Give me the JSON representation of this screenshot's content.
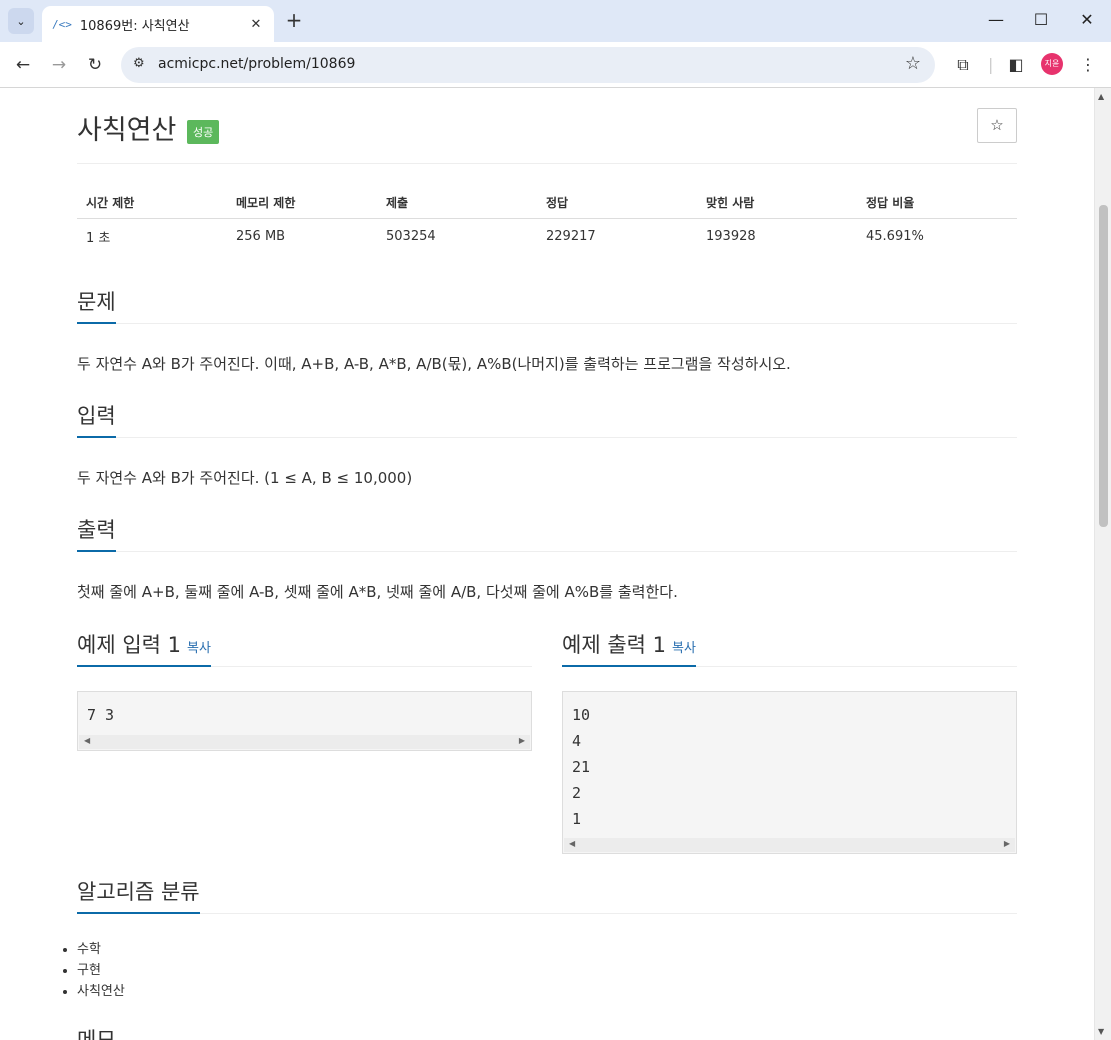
{
  "browser": {
    "tab_title": "10869번: 사칙연산",
    "tab_favicon": "/<>",
    "url": "acmicpc.net/problem/10869",
    "avatar_text": "지윤"
  },
  "problem": {
    "title": "사칙연산",
    "badge": "성공",
    "star_icon": "☆"
  },
  "info_table": {
    "headers": [
      "시간 제한",
      "메모리 제한",
      "제출",
      "정답",
      "맞힌 사람",
      "정답 비율"
    ],
    "values": [
      "1 초",
      "256 MB",
      "503254",
      "229217",
      "193928",
      "45.691%"
    ]
  },
  "sections": {
    "description": {
      "heading": "문제",
      "text": "두 자연수 A와 B가 주어진다. 이때, A+B, A-B, A*B, A/B(몫), A%B(나머지)를 출력하는 프로그램을 작성하시오."
    },
    "input": {
      "heading": "입력",
      "text": "두 자연수 A와 B가 주어진다. (1 ≤ A, B ≤ 10,000)"
    },
    "output": {
      "heading": "출력",
      "text": "첫째 줄에 A+B, 둘째 줄에 A-B, 셋째 줄에 A*B, 넷째 줄에 A/B, 다섯째 줄에 A%B를 출력한다."
    },
    "sample_input": {
      "heading": "예제 입력 1",
      "copy": "복사",
      "content": "7 3"
    },
    "sample_output": {
      "heading": "예제 출력 1",
      "copy": "복사",
      "content": "10\n4\n21\n2\n1"
    },
    "algorithm": {
      "heading": "알고리즘 분류",
      "tags": [
        "수학",
        "구현",
        "사칙연산"
      ]
    },
    "memo": {
      "heading": "메모"
    }
  }
}
